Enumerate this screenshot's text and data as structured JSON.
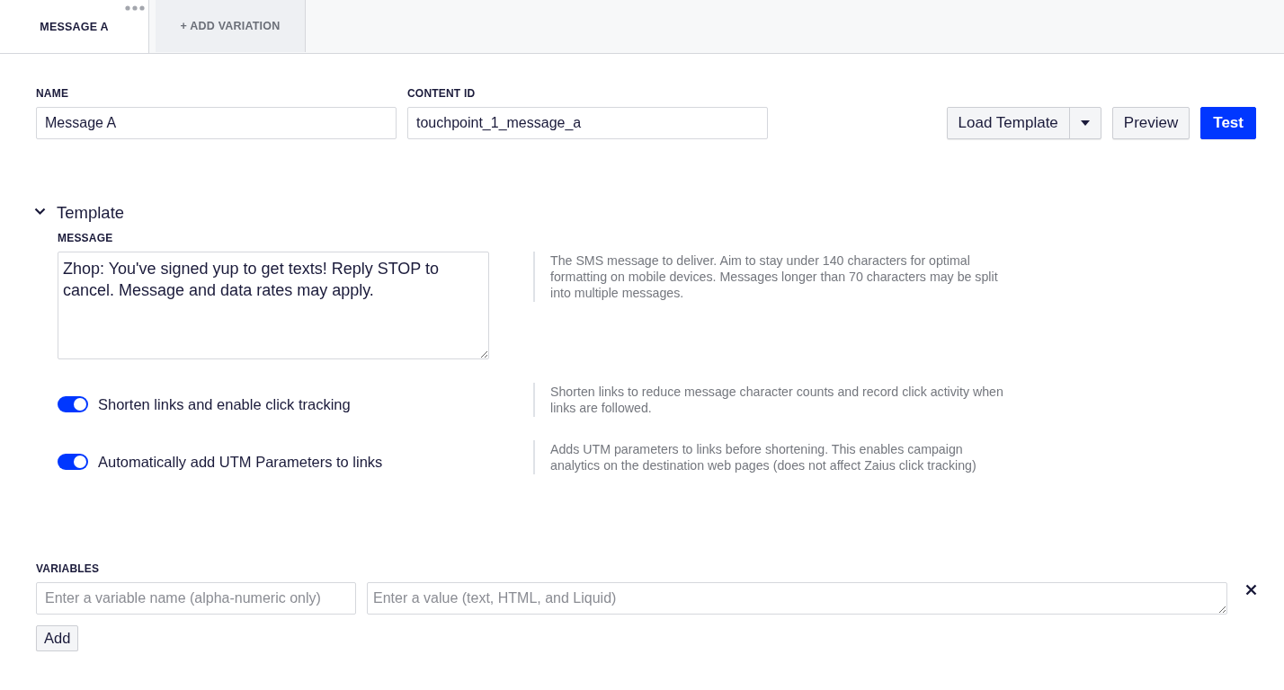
{
  "tabs": [
    {
      "label": "MESSAGE A",
      "selected": true,
      "has_menu": true
    },
    {
      "label": "+ ADD VARIATION",
      "selected": false,
      "has_menu": false
    }
  ],
  "fields": [
    {
      "label": "NAME",
      "value": "Message A"
    },
    {
      "label": "CONTENT ID",
      "value": "touchpoint_1_message_a"
    }
  ],
  "actions": [
    {
      "label": "Load Template",
      "kind": "split"
    },
    {
      "label": "Preview",
      "kind": "default"
    },
    {
      "label": "Test",
      "kind": "primary"
    }
  ],
  "template": {
    "title": "Template",
    "expanded": true,
    "message": {
      "label": "MESSAGE",
      "value": "Zhop: You've signed yup to get texts! Reply STOP to cancel. Message and data rates may apply.",
      "help": "The SMS message to deliver. Aim to stay under 140 characters for optimal formatting on mobile devices. Messages longer than 70 characters may be split into multiple messages."
    },
    "toggles": [
      {
        "label": "Shorten links and enable click tracking",
        "on": true,
        "help": "Shorten links to reduce message character counts and record click activity when links are followed."
      },
      {
        "label": "Automatically add UTM Parameters to links",
        "on": true,
        "help": "Adds UTM parameters to links before shortening. This enables campaign analytics on the destination web pages (does not affect Zaius click tracking)"
      }
    ]
  },
  "variables": {
    "label": "VARIABLES",
    "rows": [
      {
        "name_placeholder": "Enter a variable name (alpha-numeric only)",
        "value_placeholder": "Enter a value (text, HTML, and Liquid)"
      }
    ],
    "add_label": "Add"
  }
}
